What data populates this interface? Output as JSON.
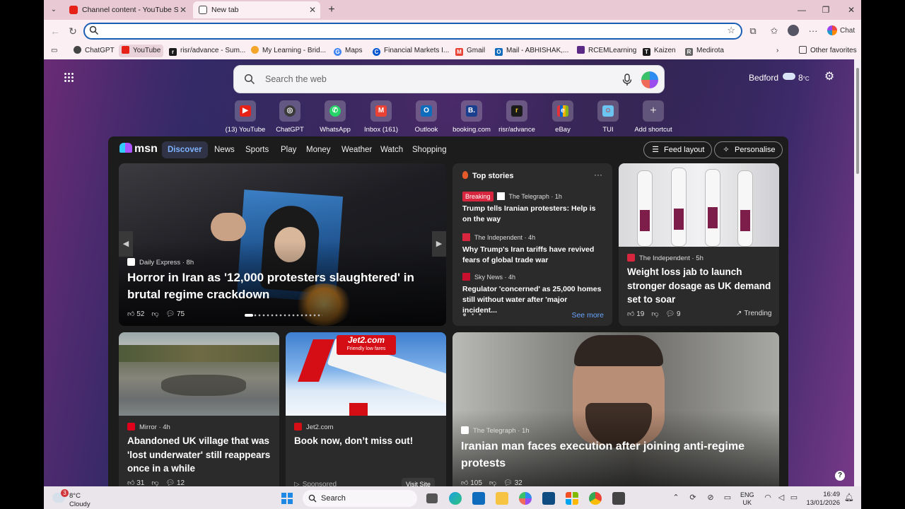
{
  "tabs": [
    {
      "label": "Channel content - YouTube Studio",
      "active": false
    },
    {
      "label": "New tab",
      "active": true
    }
  ],
  "address_bar": {
    "value": "",
    "placeholder": ""
  },
  "toolbar": {
    "chat_label": "Chat"
  },
  "favorites": {
    "items": [
      "ChatGPT",
      "YouTube",
      "risr/advance - Sum...",
      "My Learning - Brid...",
      "Maps",
      "Financial Markets I...",
      "Gmail",
      "Mail - ABHISHAK,...",
      "RCEMLearning",
      "Kaizen",
      "Medirota"
    ],
    "other": "Other favorites"
  },
  "newtab": {
    "search_placeholder": "Search the web",
    "weather": {
      "city": "Bedford",
      "temp": "8",
      "unit": "°C"
    },
    "shortcuts": [
      {
        "label": "(13) YouTube",
        "letter": "▶",
        "color": "#e62117"
      },
      {
        "label": "ChatGPT",
        "letter": "◎",
        "color": "#3a3a3a"
      },
      {
        "label": "WhatsApp",
        "letter": "✆",
        "color": "#25d366"
      },
      {
        "label": "Inbox (161)",
        "letter": "M",
        "color": "#ea4335"
      },
      {
        "label": "Outlook",
        "letter": "O",
        "color": "#0f6cbd"
      },
      {
        "label": "booking.com",
        "letter": "B.",
        "color": "#1a3f8f"
      },
      {
        "label": "risr/advance",
        "letter": "r",
        "color": "#1b1b1b"
      },
      {
        "label": "eBay",
        "letter": "e",
        "color": "#3a5fb4"
      },
      {
        "label": "TUI",
        "letter": "☺",
        "color": "#6cc4f0"
      },
      {
        "label": "Add shortcut",
        "letter": "+",
        "color": "transparent"
      }
    ]
  },
  "feed": {
    "brand": "msn",
    "nav": [
      "Discover",
      "News",
      "Sports",
      "Play",
      "Money",
      "Weather",
      "Watch",
      "Shopping"
    ],
    "feed_layout": "Feed layout",
    "personalise": "Personalise",
    "hero": {
      "source": "Daily Express",
      "age": "8h",
      "headline": "Horror in Iran as '12,000 protesters slaughtered' in brutal regime crackdown",
      "likes": "52",
      "comments": "75"
    },
    "top_stories": {
      "title": "Top stories",
      "see_more": "See more",
      "items": [
        {
          "badge": "Breaking",
          "source": "The Telegraph",
          "age": "1h",
          "headline": "Trump tells Iranian protesters: Help is on the way"
        },
        {
          "badge": "",
          "source": "The Independent",
          "age": "4h",
          "headline": "Why Trump's Iran tariffs have revived fears of global trade war"
        },
        {
          "badge": "",
          "source": "Sky News",
          "age": "4h",
          "headline": "Regulator 'concerned' as 25,000 homes still without water after 'major incident..."
        }
      ]
    },
    "weight_card": {
      "source": "The Independent",
      "age": "5h",
      "headline": "Weight loss jab to launch stronger dosage as UK demand set to soar",
      "likes": "19",
      "comments": "9",
      "tag": "Trending"
    },
    "village_card": {
      "source": "Mirror",
      "age": "4h",
      "headline": "Abandoned UK village that was 'lost underwater' still reappears once in a while",
      "likes": "31",
      "comments": "12"
    },
    "ad_card": {
      "source": "Jet2.com",
      "headline": "Book now, don’t miss out!",
      "logo_text": "Jet2.com",
      "logo_sub": "Friendly low fares",
      "sponsored": "Sponsored",
      "cta": "Visit Site"
    },
    "iran_card": {
      "source": "The Telegraph",
      "age": "1h",
      "headline": "Iranian man faces execution after joining anti-regime protests",
      "likes": "105",
      "comments": "32"
    }
  },
  "taskbar": {
    "weather_temp": "8°C",
    "weather_desc": "Cloudy",
    "weather_badge": "3",
    "search_label": "Search",
    "lang_top": "ENG",
    "lang_bottom": "UK",
    "time": "16:49",
    "date": "13/01/2026"
  }
}
